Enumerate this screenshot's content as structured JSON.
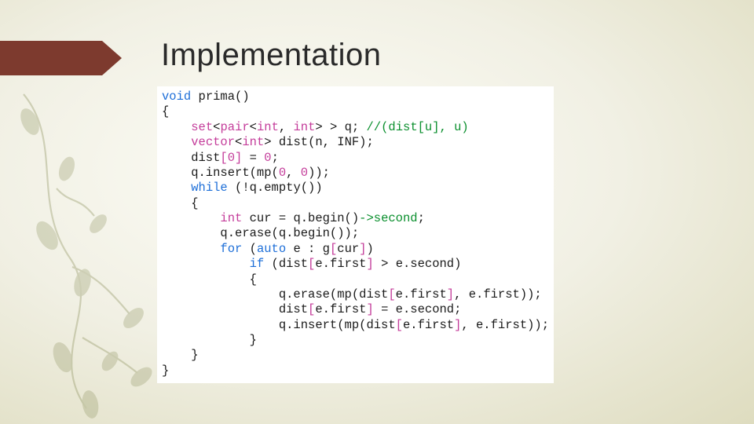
{
  "title": "Implementation",
  "code": {
    "l1": {
      "a": "void",
      "b": " prima()"
    },
    "l2": "{",
    "l3": {
      "a": "    ",
      "b": "set",
      "c": "<",
      "d": "pair",
      "e": "<",
      "f": "int",
      "g": ", ",
      "h": "int",
      "i": ">",
      "j": " > q; ",
      "k": "//(dist[u], u)"
    },
    "l4": {
      "a": "    ",
      "b": "vector",
      "c": "<",
      "d": "int",
      "e": ">",
      "f": " dist(n, INF);"
    },
    "l5": {
      "a": "    dist",
      "b": "[",
      "c": "0",
      "d": "]",
      "e": " = ",
      "f": "0",
      "g": ";"
    },
    "l6": {
      "a": "    q.insert(mp(",
      "b": "0",
      "c": ", ",
      "d": "0",
      "e": "));"
    },
    "l7": {
      "a": "    ",
      "b": "while",
      "c": " (!q.empty())"
    },
    "l8": "    {",
    "l9": {
      "a": "        ",
      "b": "int",
      "c": " cur = q.begin()",
      "d": "->",
      "e": "second",
      "f": ";"
    },
    "l10": "        q.erase(q.begin());",
    "l11": {
      "a": "        ",
      "b": "for",
      "c": " (",
      "d": "auto",
      "e": " e : g",
      "f": "[",
      "g": "cur",
      "h": "]",
      "i": ")"
    },
    "l12": {
      "a": "            ",
      "b": "if",
      "c": " (dist",
      "d": "[",
      "e": "e.first",
      "f": "]",
      "g": " > e.second)"
    },
    "l13": "            {",
    "l14": {
      "a": "                q.erase(mp(dist",
      "b": "[",
      "c": "e.first",
      "d": "]",
      "e": ", e.first));"
    },
    "l15": {
      "a": "                dist",
      "b": "[",
      "c": "e.first",
      "d": "]",
      "e": " = e.second;"
    },
    "l16": {
      "a": "                q.insert(mp(dist",
      "b": "[",
      "c": "e.first",
      "d": "]",
      "e": ", e.first));"
    },
    "l17": "            }",
    "l18": "    }",
    "l19": "}"
  }
}
